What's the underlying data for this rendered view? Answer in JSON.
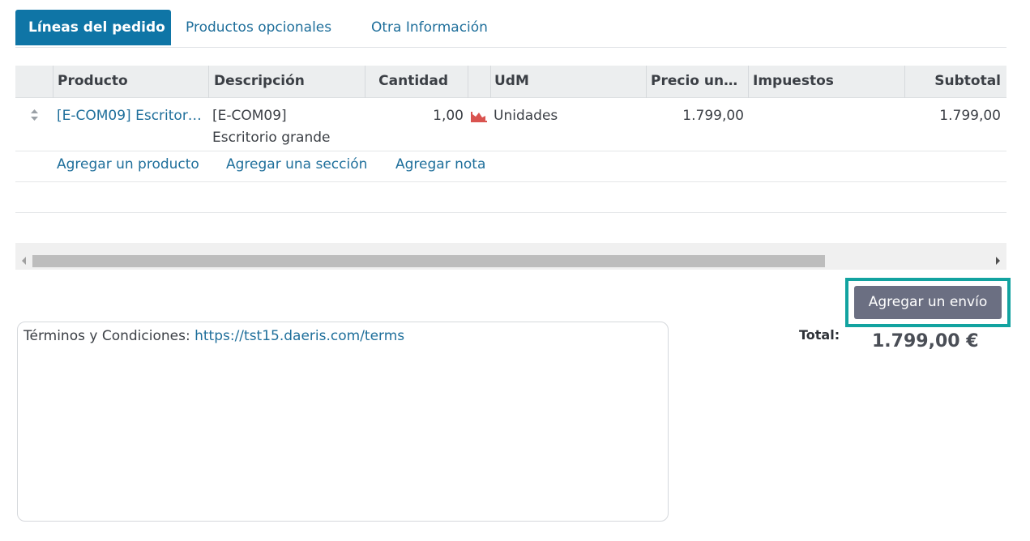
{
  "tabs": [
    {
      "label": "Líneas del pedido",
      "active": true
    },
    {
      "label": "Productos opcionales",
      "active": false
    },
    {
      "label": "Otra Información",
      "active": false
    }
  ],
  "table": {
    "headers": {
      "product": "Producto",
      "description": "Descripción",
      "quantity": "Cantidad",
      "uom": "UdM",
      "unit_price": "Precio unit…",
      "taxes": "Impuestos",
      "subtotal": "Subtotal"
    },
    "rows": [
      {
        "product": "[E-COM09] Escritor…",
        "description_line1": "[E-COM09]",
        "description_line2": "Escritorio grande",
        "quantity": "1,00",
        "uom": "Unidades",
        "unit_price": "1.799,00",
        "taxes": "",
        "subtotal": "1.799,00"
      }
    ],
    "actions": {
      "add_product": "Agregar un producto",
      "add_section": "Agregar una sección",
      "add_note": "Agregar nota"
    }
  },
  "shipping_button": "Agregar un envío",
  "notes": {
    "prefix": "Términos y Condiciones: ",
    "link": "https://tst15.daeris.com/terms"
  },
  "totals": {
    "label": "Total:",
    "value": "1.799,00 €"
  },
  "colors": {
    "tab_active_bg": "#0f75a6",
    "link": "#1f6f9b",
    "highlight": "#12a3a0",
    "forecast_icon": "#d9534f"
  },
  "icons": {
    "drag_handle": "sort-handle-icon",
    "forecast": "forecast-chart-icon"
  }
}
